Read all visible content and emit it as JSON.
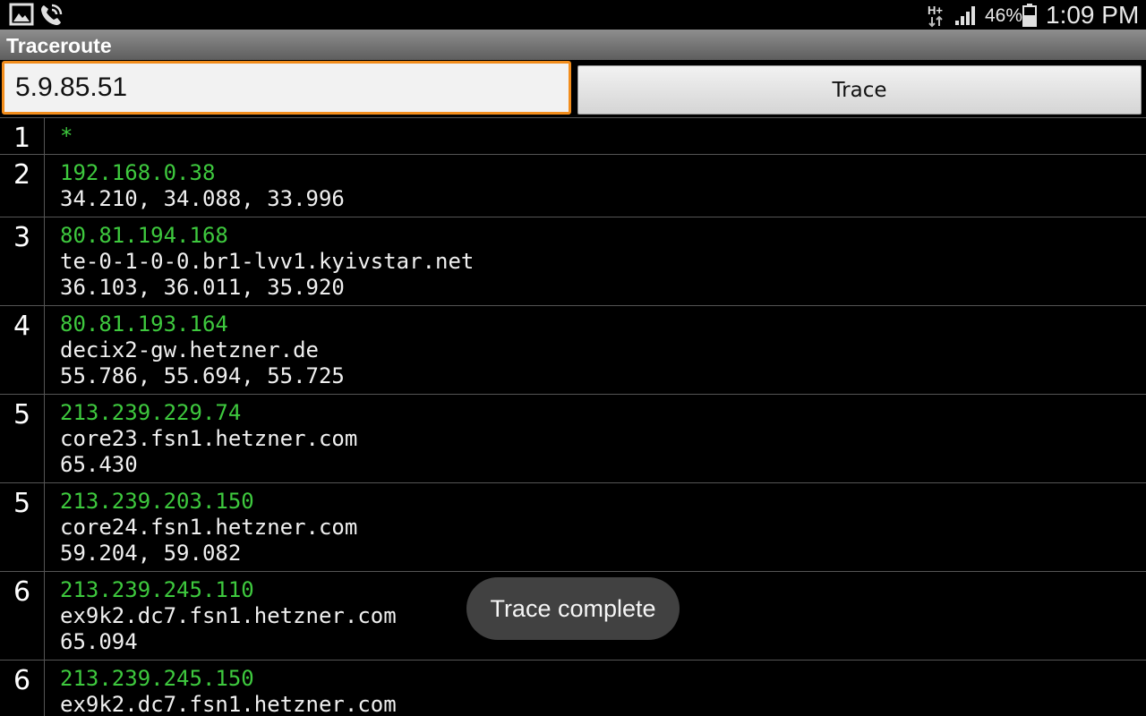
{
  "status_bar": {
    "icons": [
      "gallery-notification-icon",
      "call-notification-icon",
      "hplus-data-icon",
      "signal-strength-icon",
      "battery-icon"
    ],
    "battery": "46%",
    "time": "1:09 PM"
  },
  "app": {
    "title": "Traceroute"
  },
  "input": {
    "host": "5.9.85.51"
  },
  "trace_button": {
    "label": "Trace"
  },
  "colors": {
    "accent_focus": "#f28d1c",
    "ip_text": "#3ec93e",
    "title_bar": "#6e6e6e"
  },
  "hops": [
    {
      "num": "1",
      "ip": "*",
      "host": "",
      "times": ""
    },
    {
      "num": "2",
      "ip": "192.168.0.38",
      "host": "",
      "times": "34.210, 34.088, 33.996"
    },
    {
      "num": "3",
      "ip": "80.81.194.168",
      "host": "te-0-1-0-0.br1-lvv1.kyivstar.net",
      "times": "36.103, 36.011, 35.920"
    },
    {
      "num": "4",
      "ip": "80.81.193.164",
      "host": "decix2-gw.hetzner.de",
      "times": "55.786, 55.694, 55.725"
    },
    {
      "num": "5",
      "ip": "213.239.229.74",
      "host": "core23.fsn1.hetzner.com",
      "times": "65.430"
    },
    {
      "num": "5",
      "ip": "213.239.203.150",
      "host": "core24.fsn1.hetzner.com",
      "times": "59.204, 59.082"
    },
    {
      "num": "6",
      "ip": "213.239.245.110",
      "host": "ex9k2.dc7.fsn1.hetzner.com",
      "times": "65.094"
    },
    {
      "num": "6",
      "ip": "213.239.245.150",
      "host": "ex9k2.dc7.fsn1.hetzner.com",
      "times": ""
    }
  ],
  "toast": {
    "message": "Trace complete"
  }
}
